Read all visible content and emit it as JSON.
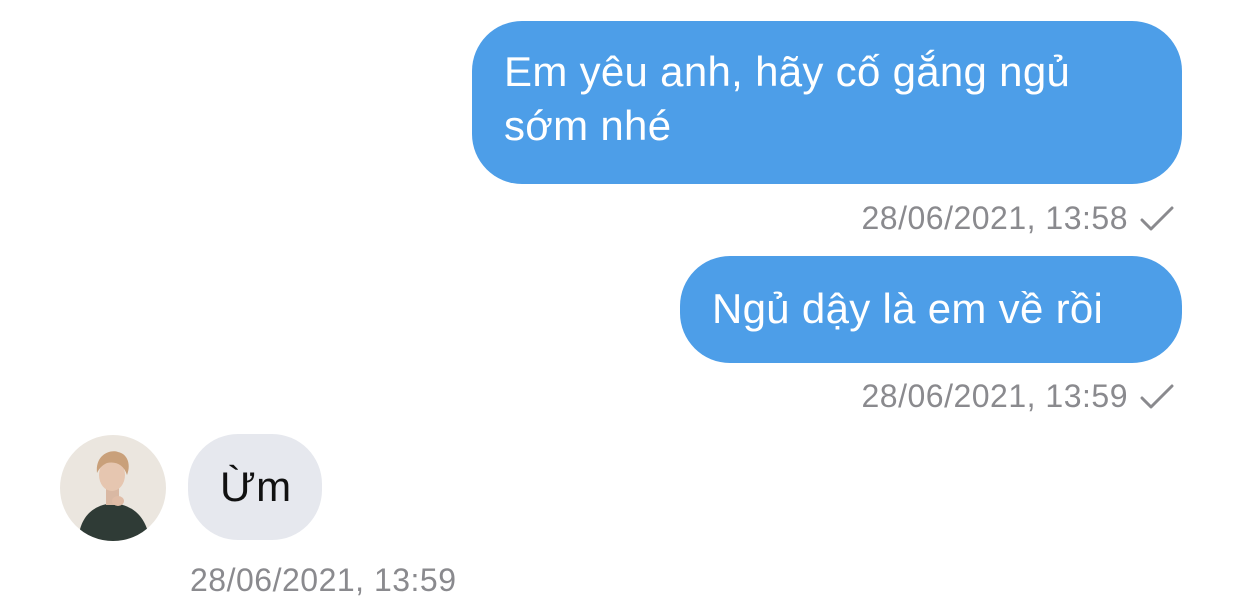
{
  "messages": [
    {
      "direction": "outgoing",
      "text": "Em yêu anh, hãy cố gắng ngủ sớm nhé",
      "timestamp": "28/06/2021, 13:58",
      "status_icon": "checkmark-icon"
    },
    {
      "direction": "outgoing",
      "text": "Ngủ dậy là em về rồi",
      "timestamp": "28/06/2021, 13:59",
      "status_icon": "checkmark-icon"
    },
    {
      "direction": "incoming",
      "text": "Ừm",
      "timestamp": "28/06/2021, 13:59",
      "avatar_icon": "contact-avatar"
    }
  ],
  "colors": {
    "outgoing_bubble": "#4d9ee8",
    "incoming_bubble": "#e6e8ee",
    "timestamp": "#8a8a8e"
  }
}
